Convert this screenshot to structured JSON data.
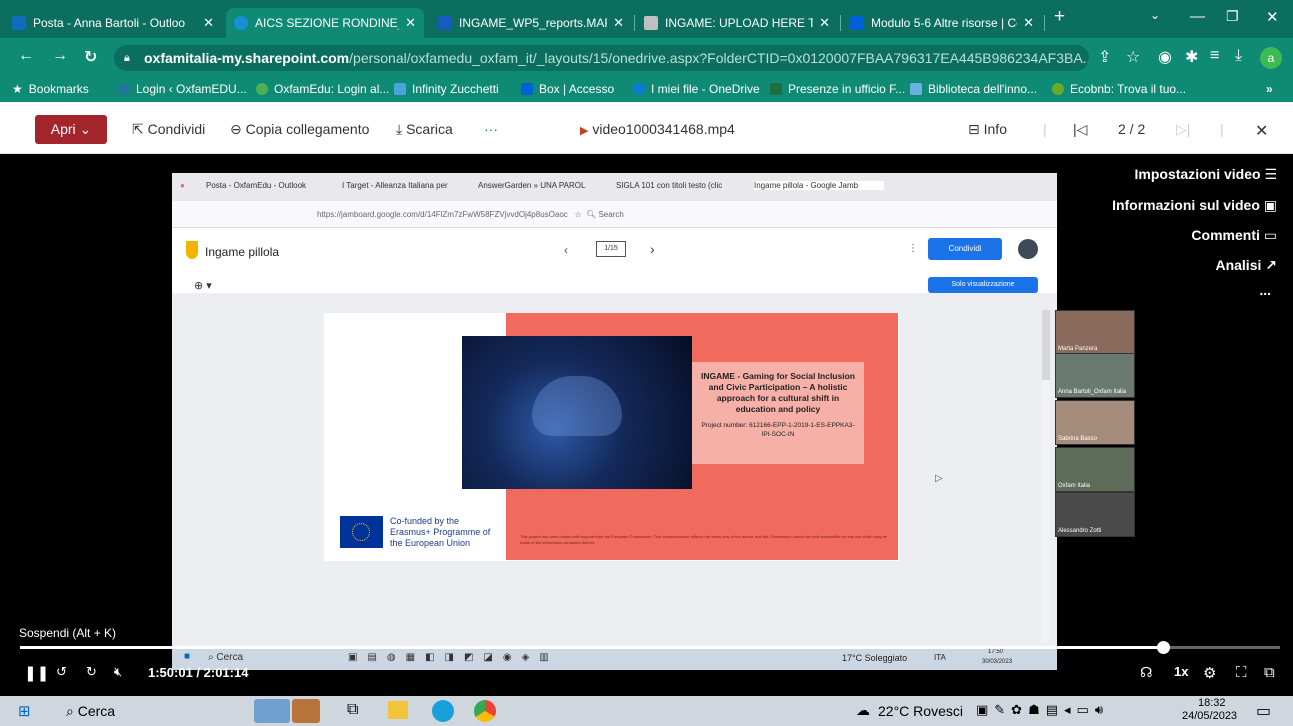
{
  "tabs": [
    {
      "title": "Posta - Anna Bartoli - Outloo",
      "color": "#0f6cbd"
    },
    {
      "title": "AICS SEZIONE RONDINE_Reg",
      "color": "#1a8fd6",
      "active": true
    },
    {
      "title": "INGAME_WP5_reports.MARC",
      "color": "#185abd"
    },
    {
      "title": "INGAME: UPLOAD HERE THE",
      "color": "#c0c0c0"
    },
    {
      "title": "Modulo 5-6 Altre risorse | Co",
      "color": "#0061d5"
    }
  ],
  "browser": {
    "new_tab": "+",
    "close": "✕",
    "url_domain": "oxfamitalia-my.sharepoint.com",
    "url_path": "/personal/oxfamedu_oxfam_it/_layouts/15/onedrive.aspx?FolderCTID=0x0120007FBAA796317EA445B986234AF3BA...",
    "profile_initial": "a"
  },
  "bookmarks": {
    "label": "Bookmarks",
    "items": [
      {
        "label": "Login ‹ OxfamEDU...",
        "color": "#21759b"
      },
      {
        "label": "OxfamEdu: Login al...",
        "color": "#4caf50"
      },
      {
        "label": "Infinity Zucchetti",
        "color": "#4aa3df"
      },
      {
        "label": "Box | Accesso",
        "color": "#0061d5"
      },
      {
        "label": "I miei file - OneDrive",
        "color": "#0a7cd6"
      },
      {
        "label": "Presenze in ufficio F...",
        "color": "#1d6f42"
      },
      {
        "label": "Biblioteca dell'inno...",
        "color": "#6ab0e0"
      },
      {
        "label": "Ecobnb: Trova il tuo...",
        "color": "#6aaa2a"
      }
    ],
    "more": "»"
  },
  "onedrive": {
    "open_label": "Apri",
    "share_label": "Condividi",
    "copy_link_label": "Copia collegamento",
    "download_label": "Scarica",
    "more_label": "···",
    "file_name": "video1000341468.mp4",
    "info_label": "Info",
    "counter": "2 / 2"
  },
  "side_menu": {
    "video_settings": "Impostazioni video",
    "video_info": "Informazioni sul video",
    "comments": "Commenti",
    "analytics": "Analisi",
    "more": "..."
  },
  "embedded": {
    "tabs": [
      "Posta - OxfamEdu - Outlook",
      "I Target - Alleanza Italiana per",
      "AnswerGarden » UNA PAROL",
      "SIGLA 101 con titoli testo (clic",
      "Ingame pillola - Google Jamb"
    ],
    "url": "https://jamboard.google.com/d/14FlZm7zFwW58FZVjvvdOj4p8usOaoc",
    "search": "Search",
    "app_title": "Ingame pillola",
    "page_indicator": "1/15",
    "share_button": "Condividi",
    "view_only": "Solo visualizzazione",
    "slide_title": "INGAME - Gaming for Social Inclusion and Civic Participation – A holistic approach for a cultural shift in education and policy",
    "project_number": "Project number: 612166-EPP-1-2019-1-ES-EPPKA3-IPI-SOC-IN",
    "cofunded": "Co-funded by the Erasmus+ Programme of the European Union",
    "disclaimer": "This project has been funded with support from the European Commission. This communication reflects the views only of the author, and the Commission cannot be held responsible for any use which may be made of the information contained therein.",
    "taskbar_search": "Cerca",
    "weather": "17°C Soleggiato",
    "lang": "ITA",
    "time": "17:50",
    "date": "30/03/2023",
    "participants": [
      "Marta Panzera",
      "Anna Bartoli_Oxfam Italia",
      "Sabrina Basso",
      "Oxfam Italia",
      "Alessandro Zotti"
    ]
  },
  "player": {
    "tooltip": "Sospendi (Alt + K)",
    "time": "1:50:01 / 2:01:14",
    "progress": 0.907,
    "speed": "1x"
  },
  "taskbar": {
    "search": "Cerca",
    "weather": "22°C Rovesci",
    "time": "18:32",
    "date": "24/05/2023"
  }
}
